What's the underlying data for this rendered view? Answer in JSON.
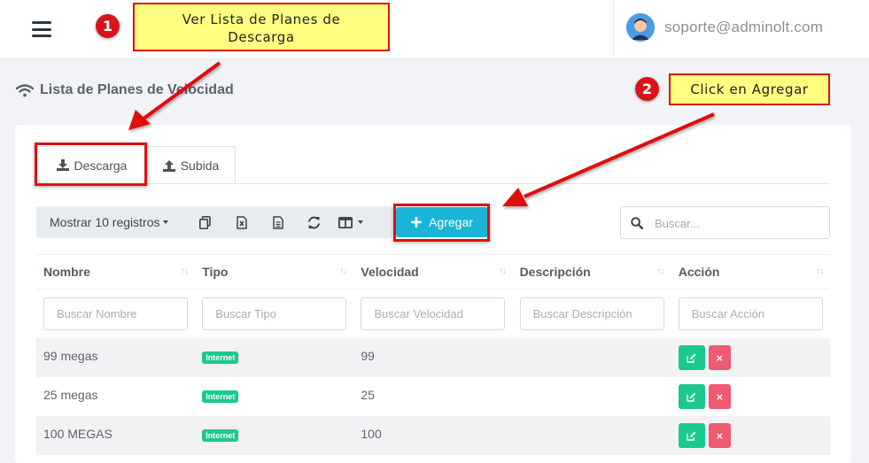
{
  "header": {
    "user_email": "soporte@adminolt.com"
  },
  "page": {
    "title": "Lista de Planes de Velocidad"
  },
  "tabs": [
    {
      "label": "Descarga",
      "active": true
    },
    {
      "label": "Subida",
      "active": false
    }
  ],
  "toolbar": {
    "show_label": "Mostrar 10 registros",
    "add_label": "Agregar"
  },
  "search": {
    "placeholder": "Buscar..."
  },
  "table": {
    "headers": [
      "Nombre",
      "Tipo",
      "Velocidad",
      "Descripción",
      "Acción"
    ],
    "filters": [
      "Buscar Nombre",
      "Buscar Tipo",
      "Buscar Velocidad",
      "Buscar Descripción",
      "Buscar Acción"
    ],
    "rows": [
      {
        "nombre": "99 megas",
        "tipo": "Internet",
        "velocidad": "99",
        "descripcion": ""
      },
      {
        "nombre": "25 megas",
        "tipo": "Internet",
        "velocidad": "25",
        "descripcion": ""
      },
      {
        "nombre": "100 MEGAS",
        "tipo": "Internet",
        "velocidad": "100",
        "descripcion": ""
      }
    ],
    "delete_glyph": "×"
  },
  "annotations": {
    "step1_number": "1",
    "step1_text_line1": "Ver Lista de Planes de",
    "step1_text_line2": "Descarga",
    "step2_number": "2",
    "step2_text": "Click en Agregar",
    "highlight_color": "#e01010",
    "callout_color": "#ffff80"
  },
  "colors": {
    "accent": "#1bb4d6",
    "success": "#1bc98e",
    "danger": "#ee5a72"
  },
  "icons": {
    "menu": "hamburger-icon",
    "wifi": "wifi-icon",
    "download": "download-icon",
    "upload": "upload-icon",
    "copy": "copy-icon",
    "excel": "excel-icon",
    "csv": "file-icon",
    "refresh": "refresh-icon",
    "columns": "columns-icon",
    "plus": "plus-icon",
    "search": "search-icon",
    "edit": "edit-icon",
    "delete": "close-icon"
  }
}
